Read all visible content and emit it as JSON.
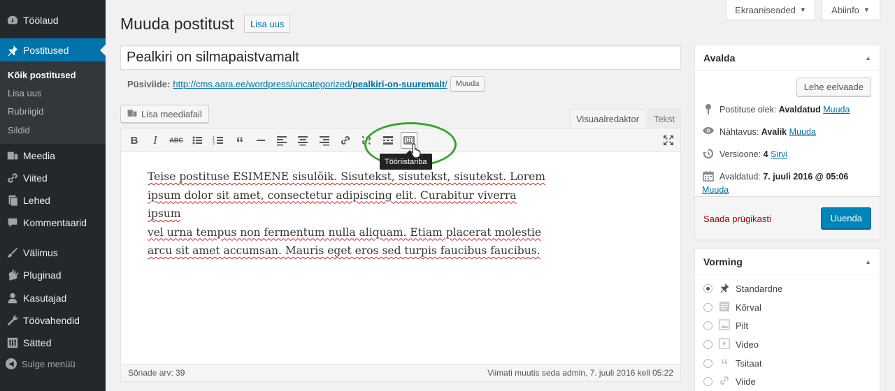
{
  "sidebar": {
    "items": [
      {
        "label": "Töölaud",
        "icon": "dashboard-icon"
      },
      {
        "label": "Postitused",
        "icon": "pin-icon"
      },
      {
        "label": "Meedia",
        "icon": "media-icon"
      },
      {
        "label": "Viited",
        "icon": "link-icon"
      },
      {
        "label": "Lehed",
        "icon": "page-icon"
      },
      {
        "label": "Kommentaarid",
        "icon": "comment-icon"
      },
      {
        "label": "Välimus",
        "icon": "brush-icon"
      },
      {
        "label": "Pluginad",
        "icon": "plugin-icon"
      },
      {
        "label": "Kasutajad",
        "icon": "user-icon"
      },
      {
        "label": "Töövahendid",
        "icon": "wrench-icon"
      },
      {
        "label": "Sätted",
        "icon": "settings-icon"
      }
    ],
    "submenu": [
      "Kõik postitused",
      "Lisa uus",
      "Rubriigid",
      "Sildid"
    ],
    "collapse": "Sulge menüü"
  },
  "screen_options": "Ekraaniseaded",
  "help": "Abiinfo",
  "page": {
    "title": "Muuda postitust",
    "add_new": "Lisa uus"
  },
  "post": {
    "title": "Pealkiri on silmapaistvamalt",
    "permalink_label": "Püsiviide:",
    "permalink_base": "http://cms.aara.ee/wordpress/uncategorized/",
    "permalink_slug": "pealkiri-on-suuremalt",
    "permalink_tail": "/",
    "edit_slug": "Muuda"
  },
  "editor": {
    "add_media": "Lisa meediafail",
    "tab_visual": "Visuaalredaktor",
    "tab_text": "Tekst",
    "tooltip": "Tööriistariba",
    "content_lines": [
      "Teise postituse ESIMENE sisulõik. Sisutekst, sisutekst, sisutekst. Lorem",
      "ipsum dolor sit amet, consectetur adipiscing elit. Curabitur viverra ipsum",
      "vel urna tempus non fermentum nulla aliquam. Etiam placerat molestie",
      "arcu sit amet accumsan. Mauris eget eros sed turpis faucibus faucibus."
    ],
    "word_count": "Sõnade arv: 39",
    "last_edited": "Viimati muutis seda admin, 7. juuli 2016 kell 05:22",
    "toolbar": [
      "bold-icon",
      "italic-icon",
      "strikethrough-icon",
      "bullet-list-icon",
      "numbered-list-icon",
      "quote-icon",
      "horizontal-line-icon",
      "align-left-icon",
      "align-center-icon",
      "align-right-icon",
      "link-icon",
      "unlink-icon",
      "read-more-icon",
      "toolbar-toggle-icon",
      "fullscreen-icon"
    ]
  },
  "publish": {
    "title": "Avalda",
    "preview": "Lehe eelvaade",
    "status_label": "Postituse olek:",
    "status_value": "Avaldatud",
    "visibility_label": "Nähtavus:",
    "visibility_value": "Avalik",
    "revisions_label": "Versioone:",
    "revisions_value": "4",
    "browse": "Sirvi",
    "published_label": "Avaldatud:",
    "published_value": "7. juuli 2016 @ 05:06",
    "edit": "Muuda",
    "trash": "Saada prügikasti",
    "update": "Uuenda"
  },
  "format": {
    "title": "Vorming",
    "options": [
      {
        "label": "Standardne",
        "icon": "pin-icon",
        "checked": true
      },
      {
        "label": "Kõrval",
        "icon": "aside-icon",
        "checked": false
      },
      {
        "label": "Pilt",
        "icon": "image-icon",
        "checked": false
      },
      {
        "label": "Video",
        "icon": "video-icon",
        "checked": false
      },
      {
        "label": "Tsitaat",
        "icon": "quote-icon",
        "checked": false
      },
      {
        "label": "Viide",
        "icon": "link-icon",
        "checked": false
      }
    ]
  },
  "colors": {
    "accent": "#0073aa",
    "sidebar": "#23282d",
    "highlight": "#3aa52f",
    "primary_button": "#0085ba"
  }
}
